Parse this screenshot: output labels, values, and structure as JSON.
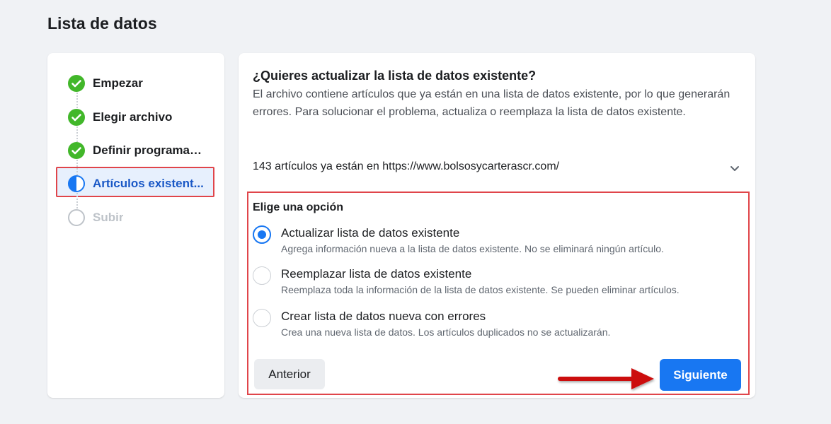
{
  "page": {
    "title": "Lista de datos"
  },
  "steps": [
    {
      "label": "Empezar",
      "state": "done",
      "icon": "check-circle-icon"
    },
    {
      "label": "Elegir archivo",
      "state": "done",
      "icon": "check-circle-icon"
    },
    {
      "label": "Definir programac...",
      "state": "done",
      "icon": "check-circle-icon"
    },
    {
      "label": "Artículos existent...",
      "state": "active",
      "icon": "half-circle-icon"
    },
    {
      "label": "Subir",
      "state": "pending",
      "icon": "empty-circle-icon"
    }
  ],
  "main": {
    "question": "¿Quieres actualizar la lista de datos existente?",
    "description": "El archivo contiene artículos que ya están en una lista de datos existente, por lo que generarán errores. Para solucionar el problema, actualiza o reemplaza la lista de datos existente.",
    "items_summary": "143 artículos ya están en https://www.bolsosycarterascr.com/",
    "choose_label": "Elige una opción",
    "options": [
      {
        "title": "Actualizar lista de datos existente",
        "description": "Agrega información nueva a la lista de datos existente. No se eliminará ningún artículo.",
        "selected": true
      },
      {
        "title": "Reemplazar lista de datos existente",
        "description": "Reemplaza toda la información de la lista de datos existente. Se pueden eliminar artículos.",
        "selected": false
      },
      {
        "title": "Crear lista de datos nueva con errores",
        "description": "Crea una nueva lista de datos. Los artículos duplicados no se actualizarán.",
        "selected": false
      }
    ],
    "prev_label": "Anterior",
    "next_label": "Siguiente"
  },
  "colors": {
    "primary": "#1877f2",
    "success": "#42b72a",
    "active_text": "#1a58c6",
    "annotation_red": "#e0454a",
    "arrow_red": "#cc1010"
  }
}
